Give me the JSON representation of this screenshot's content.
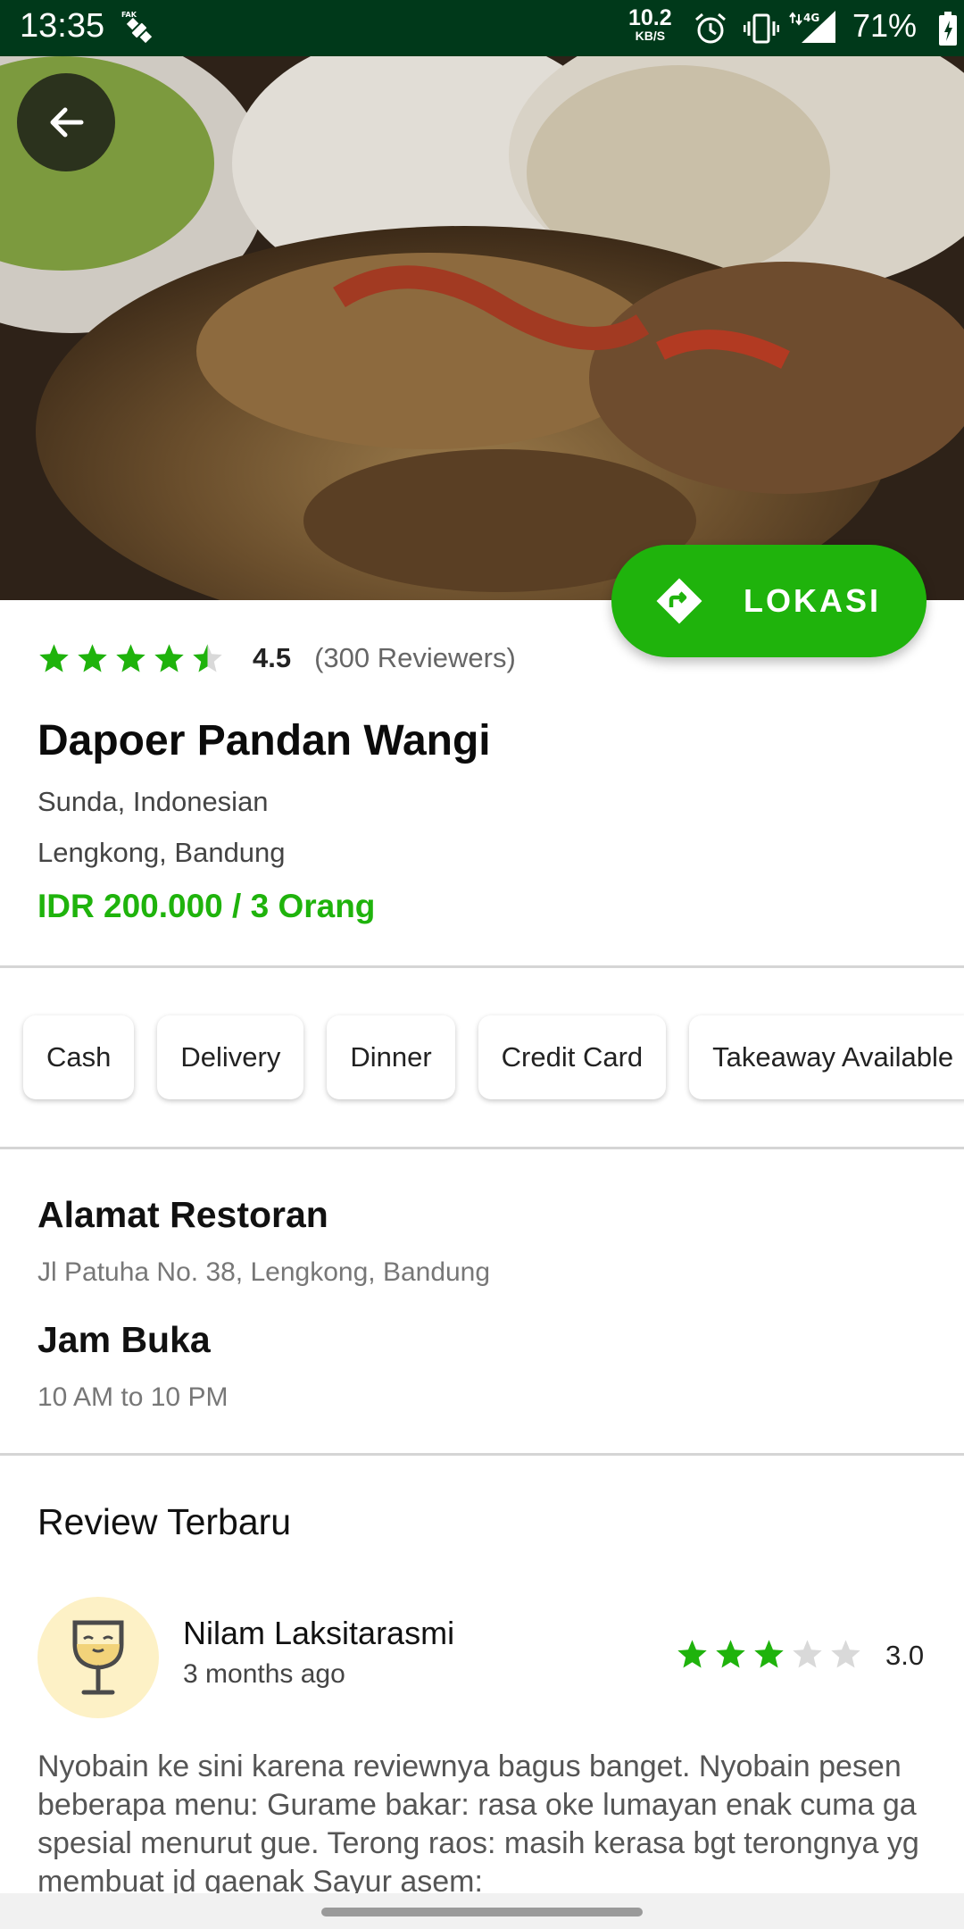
{
  "status_bar": {
    "time": "13:35",
    "net_speed": "10.2",
    "net_unit": "KB/S",
    "battery": "71%",
    "icons": [
      "fake-gps-icon",
      "alarm-icon",
      "vibrate-icon",
      "signal-4g-icon",
      "battery-icon"
    ]
  },
  "restaurant": {
    "rating": 4.5,
    "rating_text": "4.5",
    "reviewers": "(300 Reviewers)",
    "name": "Dapoer Pandan Wangi",
    "cuisine": "Sunda, Indonesian",
    "area": "Lengkong, Bandung",
    "price": "IDR 200.000 / 3 Orang"
  },
  "actions": {
    "lokasi_label": "LOKASI"
  },
  "tags": [
    "Cash",
    "Delivery",
    "Dinner",
    "Credit Card",
    "Takeaway Available"
  ],
  "details": {
    "address_title": "Alamat Restoran",
    "address": "Jl Patuha No. 38, Lengkong, Bandung",
    "hours_title": "Jam Buka",
    "hours": "10 AM to 10 PM"
  },
  "reviews": {
    "title": "Review Terbaru",
    "items": [
      {
        "name": "Nilam Laksitarasmi",
        "time": "3 months ago",
        "rating": 3.0,
        "rating_text": "3.0",
        "text": "Nyobain ke sini karena reviewnya bagus banget. Nyobain pesen beberapa menu: Gurame bakar: rasa oke lumayan enak cuma ga spesial menurut gue.  Terong raos: masih kerasa bgt terongnya yg membuat jd gaenak Sayur asem:"
      }
    ]
  },
  "colors": {
    "accent": "#1fb30c",
    "status_bar": "#00391a",
    "star_empty": "#d9d9d9",
    "avatar_bg": "#fdf1c6"
  }
}
